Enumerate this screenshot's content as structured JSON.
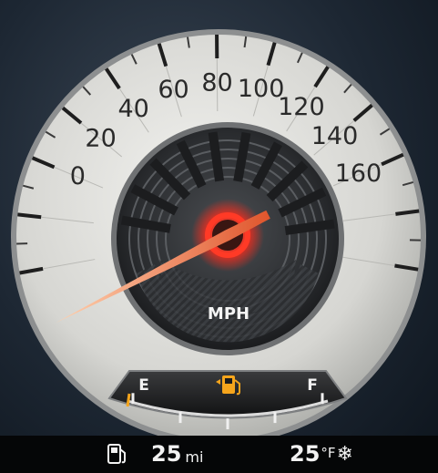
{
  "speedometer": {
    "unit_label": "MPH",
    "scale_min": 0,
    "scale_max": 160,
    "speed_value": 0,
    "tick_labels": [
      "0",
      "20",
      "40",
      "60",
      "80",
      "100",
      "120",
      "140",
      "160"
    ]
  },
  "fuel_gauge": {
    "empty_label": "E",
    "full_label": "F",
    "level_fraction": 0.0,
    "icon": "fuel-pump-icon",
    "icon_color": "#f5a51c"
  },
  "status_bar": {
    "range_icon": "fuel-pump-icon",
    "range_value": "25",
    "range_unit": "mi",
    "temperature_value": "25",
    "temperature_unit": "°F",
    "weather_icon": "snowflake-icon"
  },
  "colors": {
    "needle": "#e8643a",
    "hub_glow": "#ff2a1a",
    "dial_face": "#d9d9d6"
  }
}
